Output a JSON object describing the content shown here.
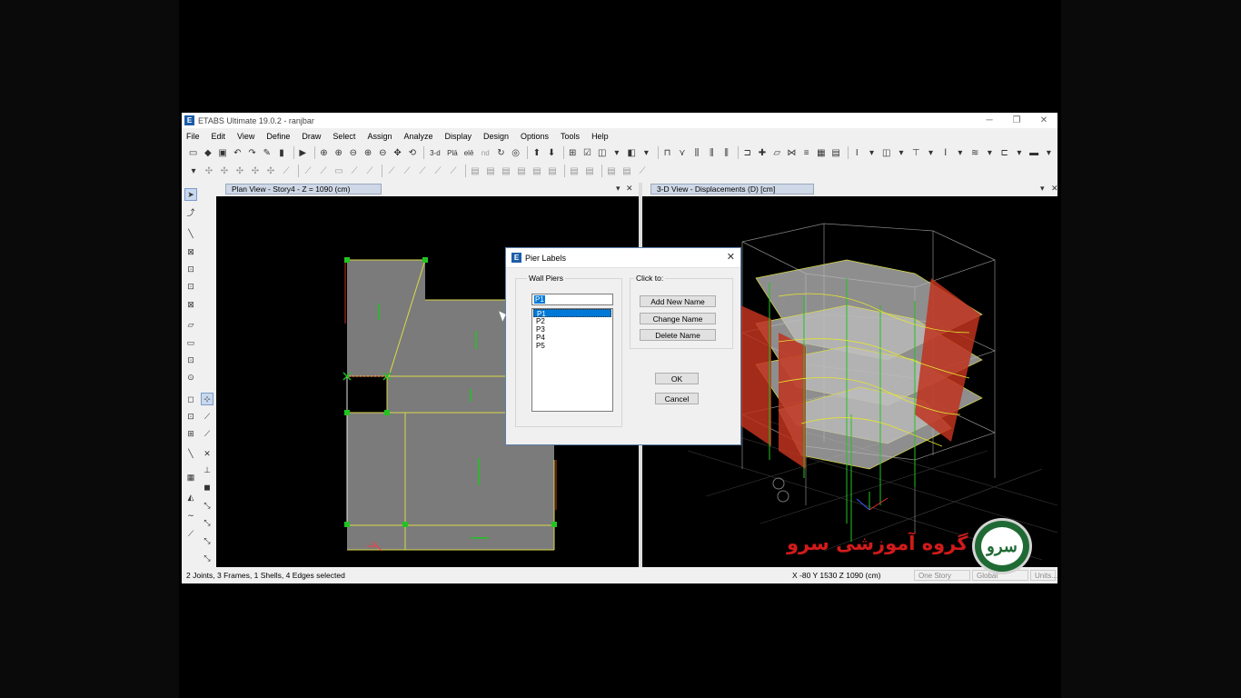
{
  "app": {
    "title": "ETABS Ultimate 19.0.2 - ranjbar",
    "logo_letter": "E",
    "minimize": "─",
    "restore": "❐",
    "close": "✕"
  },
  "menu": [
    "File",
    "Edit",
    "View",
    "Define",
    "Draw",
    "Select",
    "Assign",
    "Analyze",
    "Display",
    "Design",
    "Options",
    "Tools",
    "Help"
  ],
  "toolbar": {
    "view_3d": "3-d",
    "view_plan": "Plā",
    "view_elev": "elē",
    "view_nd": "nd"
  },
  "panes": {
    "left_title": "Plan View - Story4 - Z = 1090 (cm)",
    "right_title": "3-D View  - Displacements (D)  [cm]",
    "dropdown_glyph": "▾",
    "close_glyph": "✕"
  },
  "status": {
    "selection": "2 Joints, 3 Frames, 1 Shells, 4 Edges selected",
    "coords": "X -80  Y 1530  Z 1090 (cm)",
    "story_mode": "One Story",
    "coord_system": "Global",
    "units": "Units..."
  },
  "dialog": {
    "title": "Pier Labels",
    "logo_letter": "E",
    "close": "✕",
    "group_label": "Wall Piers",
    "click_to_label": "Click to:",
    "input_value": "P1",
    "items": [
      "P1",
      "P2",
      "P3",
      "P4",
      "P5"
    ],
    "selected_index": 0,
    "buttons": {
      "add": "Add New Name",
      "change": "Change Name",
      "delete": "Delete Name",
      "ok": "OK",
      "cancel": "Cancel"
    }
  },
  "watermark": {
    "text": "گروه آموزشی سرو",
    "logo_glyph": "سرو"
  },
  "colors": {
    "selection_blue": "#0078d7",
    "plan_shell_gray": "#7b7b7b",
    "frame_yellow": "#e6e62e",
    "joint_green": "#22c322",
    "wall_red": "#c0331f"
  }
}
